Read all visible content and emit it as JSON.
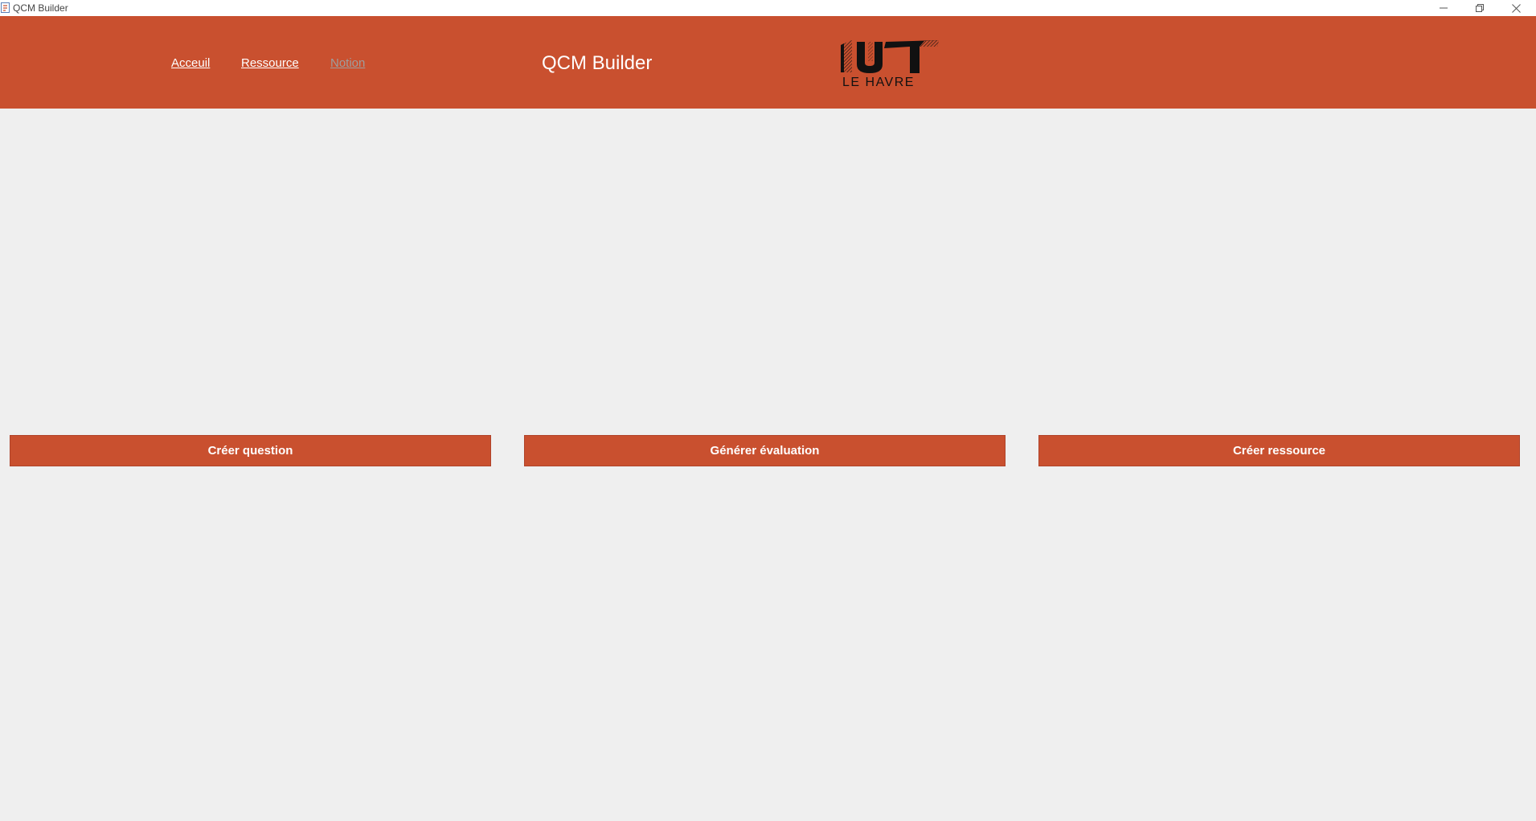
{
  "window": {
    "title": "QCM Builder",
    "icon": "java-app-icon",
    "controls": {
      "minimize_icon": "minimize-icon",
      "restore_icon": "restore-icon",
      "close_icon": "close-icon"
    }
  },
  "header": {
    "background_color": "#c9502f",
    "nav": [
      {
        "label": "Acceuil",
        "active": true
      },
      {
        "label": "Ressource",
        "active": true
      },
      {
        "label": "Notion",
        "active": false
      }
    ],
    "title": "QCM Builder",
    "logo": {
      "main_text": "IUT",
      "sub_text": "LE HAVRE"
    }
  },
  "actions": [
    {
      "label": "Créer question"
    },
    {
      "label": "Générer évaluation"
    },
    {
      "label": "Créer ressource"
    }
  ],
  "colors": {
    "accent": "#c9502f",
    "background": "#efefef",
    "disabled_link": "#9e9e9e"
  }
}
